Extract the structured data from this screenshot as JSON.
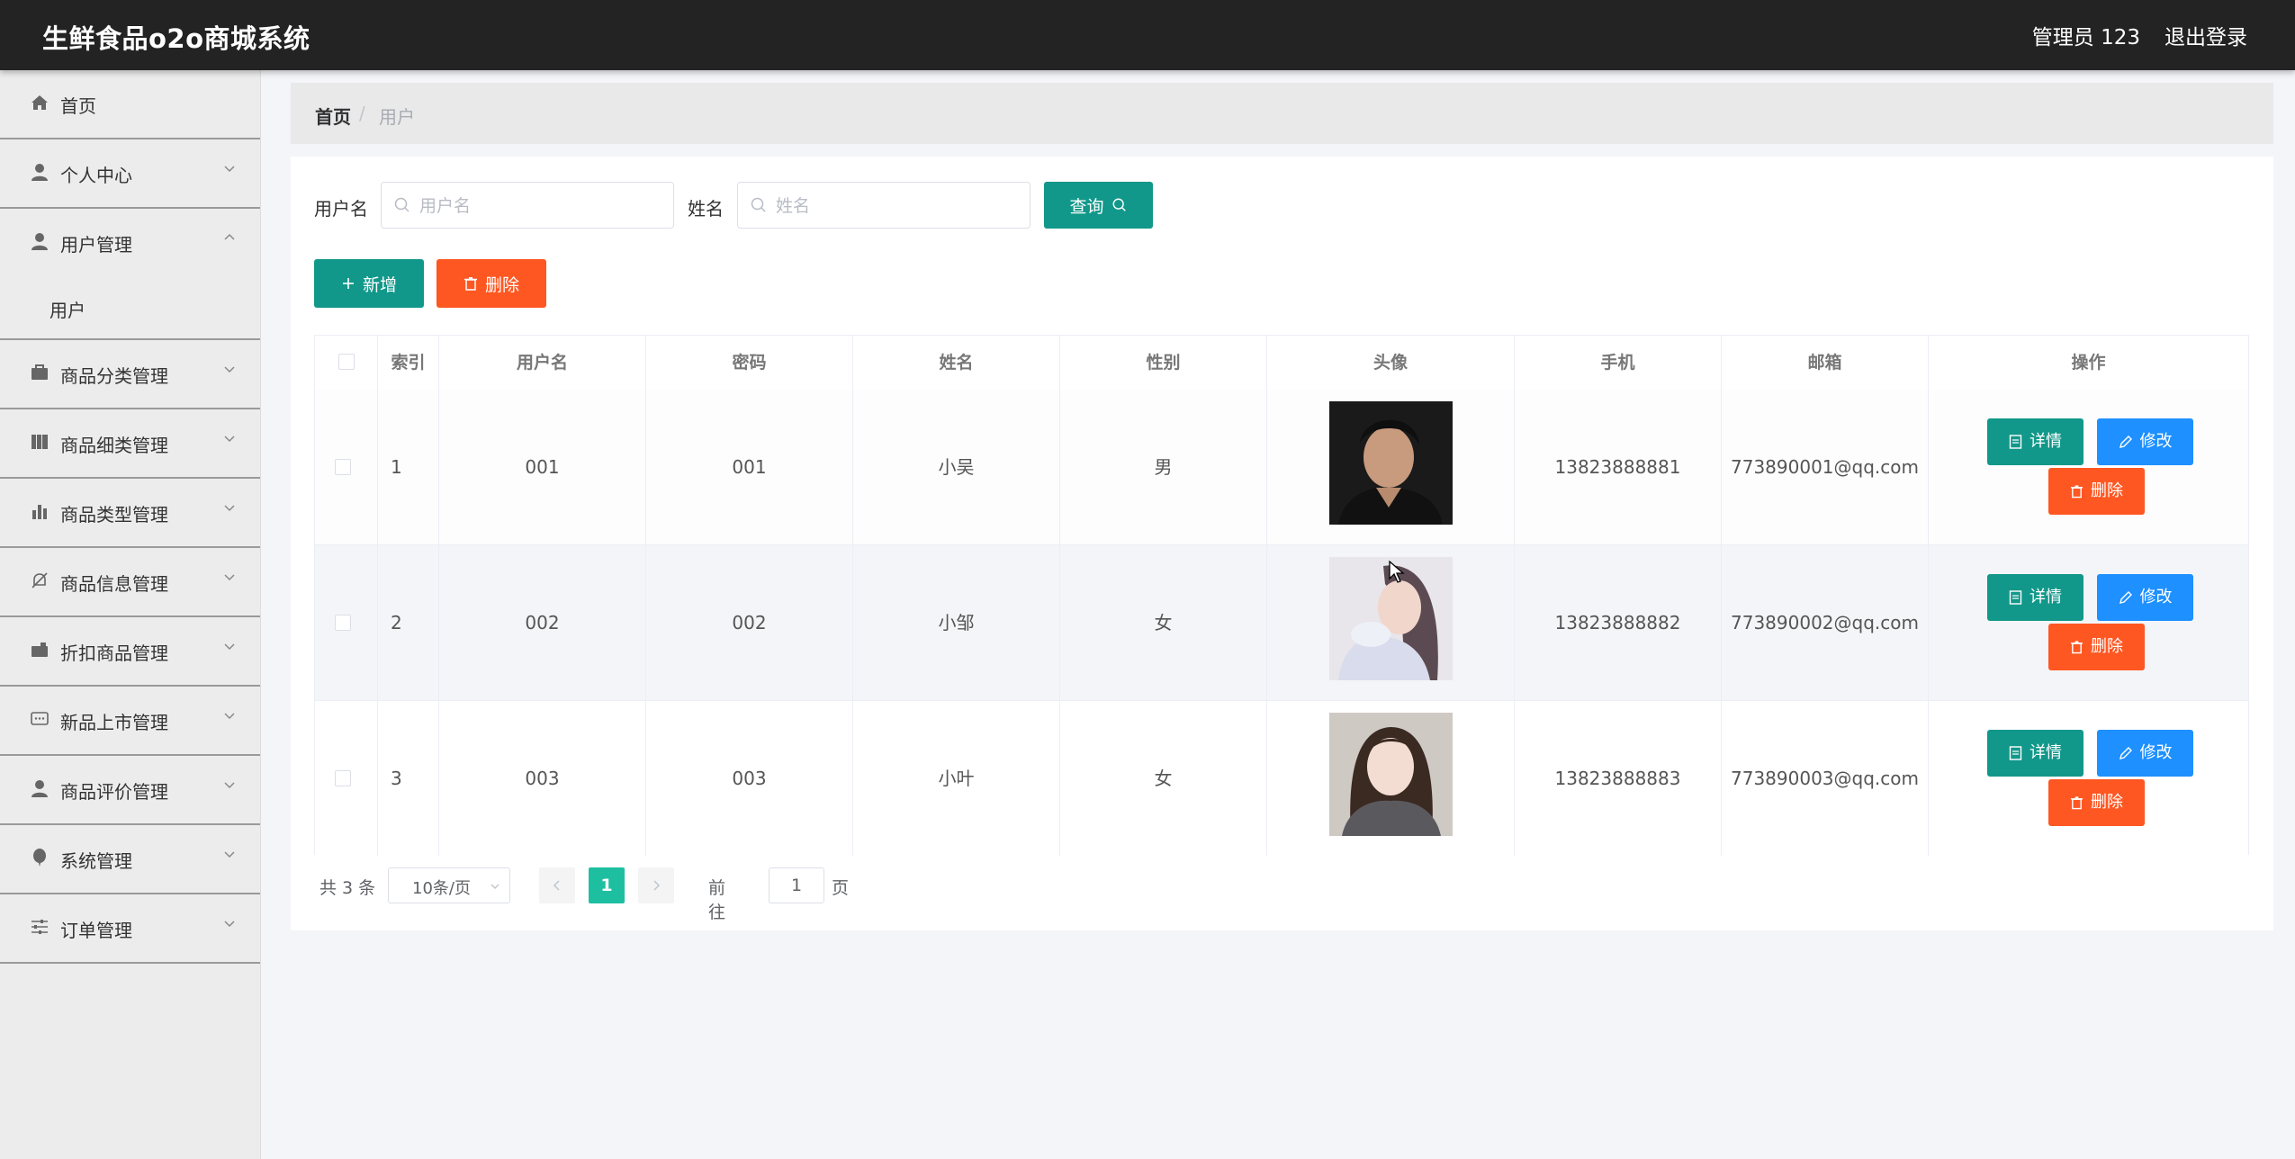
{
  "header": {
    "title": "生鲜食品o2o商城系统",
    "user": "管理员 123",
    "logout": "退出登录"
  },
  "sidebar": {
    "items": [
      {
        "label": "首页",
        "icon": "home-icon"
      },
      {
        "label": "个人中心",
        "icon": "user-icon",
        "expandable": true
      },
      {
        "label": "用户管理",
        "icon": "user-icon",
        "expanded": true
      },
      {
        "label": "商品分类管理",
        "icon": "briefcase-icon",
        "expandable": true
      },
      {
        "label": "商品细类管理",
        "icon": "book-icon",
        "expandable": true
      },
      {
        "label": "商品类型管理",
        "icon": "bar-chart-icon",
        "expandable": true
      },
      {
        "label": "商品信息管理",
        "icon": "bell-off-icon",
        "expandable": true
      },
      {
        "label": "折扣商品管理",
        "icon": "wallet-icon",
        "expandable": true
      },
      {
        "label": "新品上市管理",
        "icon": "chat-icon",
        "expandable": true
      },
      {
        "label": "商品评价管理",
        "icon": "user-icon",
        "expandable": true
      },
      {
        "label": "系统管理",
        "icon": "balloon-icon",
        "expandable": true
      },
      {
        "label": "订单管理",
        "icon": "sliders-icon",
        "expandable": true
      }
    ],
    "submenu": "用户"
  },
  "breadcrumb": {
    "home": "首页",
    "sep": "/",
    "current": "用户"
  },
  "search": {
    "username_label": "用户名",
    "username_placeholder": "用户名",
    "name_label": "姓名",
    "name_placeholder": "姓名",
    "query_btn": "查询"
  },
  "actions": {
    "add": "新增",
    "delete": "删除"
  },
  "table": {
    "headers": [
      "索引",
      "用户名",
      "密码",
      "姓名",
      "性别",
      "头像",
      "手机",
      "邮箱",
      "操作"
    ],
    "rows": [
      {
        "index": "1",
        "username": "001",
        "password": "001",
        "name": "小吴",
        "gender": "男",
        "phone": "13823888881",
        "email": "773890001@qq.com"
      },
      {
        "index": "2",
        "username": "002",
        "password": "002",
        "name": "小邹",
        "gender": "女",
        "phone": "13823888882",
        "email": "773890002@qq.com"
      },
      {
        "index": "3",
        "username": "003",
        "password": "003",
        "name": "小叶",
        "gender": "女",
        "phone": "13823888883",
        "email": "773890003@qq.com"
      }
    ],
    "row_actions": {
      "detail": "详情",
      "edit": "修改",
      "delete": "删除"
    }
  },
  "pagination": {
    "total": "共 3 条",
    "page_size": "10条/页",
    "current_page": "1",
    "goto_label": "前往",
    "goto_value": "1",
    "page_suffix": "页"
  },
  "colors": {
    "header_bg": "#232323",
    "teal": "#11988a",
    "red": "#ff5722",
    "blue": "#1e90ff",
    "page_active": "#1ebfa0"
  }
}
